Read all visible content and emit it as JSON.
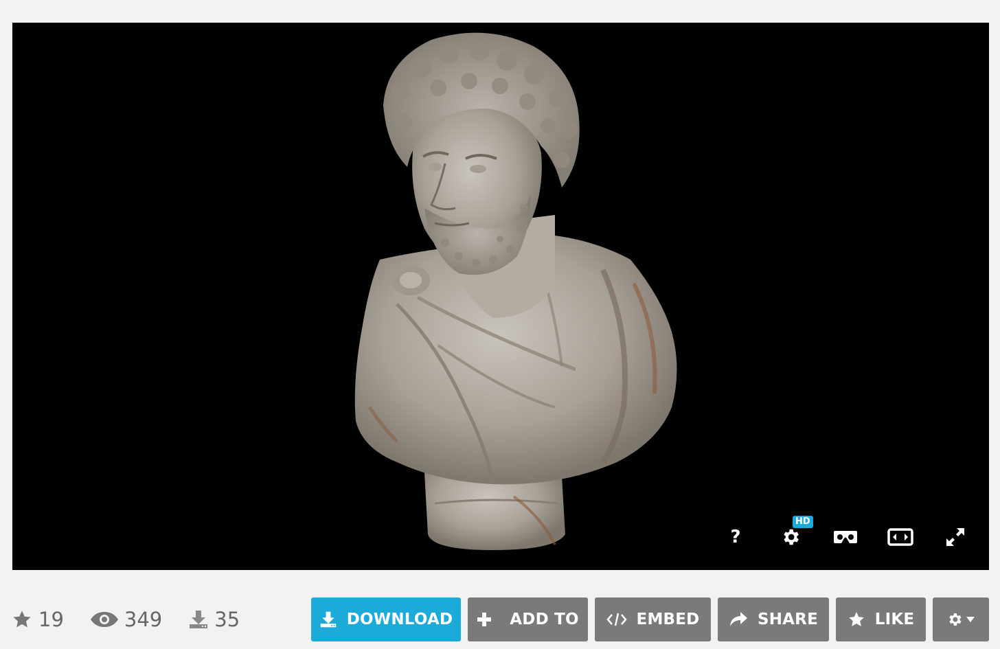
{
  "viewer": {
    "controls": {
      "help_label": "?",
      "hd_badge": "HD",
      "settings_icon": "gear-icon",
      "vr_icon": "vr-headset-icon",
      "widescreen_icon": "widescreen-icon",
      "fullscreen_icon": "fullscreen-icon"
    }
  },
  "stats": {
    "likes": "19",
    "views": "349",
    "downloads": "35"
  },
  "actions": {
    "download_label": "DOWNLOAD",
    "add_to_label": "ADD TO",
    "embed_label": "EMBED",
    "share_label": "SHARE",
    "like_label": "LIKE"
  },
  "colors": {
    "primary": "#1caad9",
    "secondary_button": "#7a7a7a",
    "background": "#f2f2f2",
    "viewer_background": "#000000",
    "stat_text": "#666666"
  }
}
